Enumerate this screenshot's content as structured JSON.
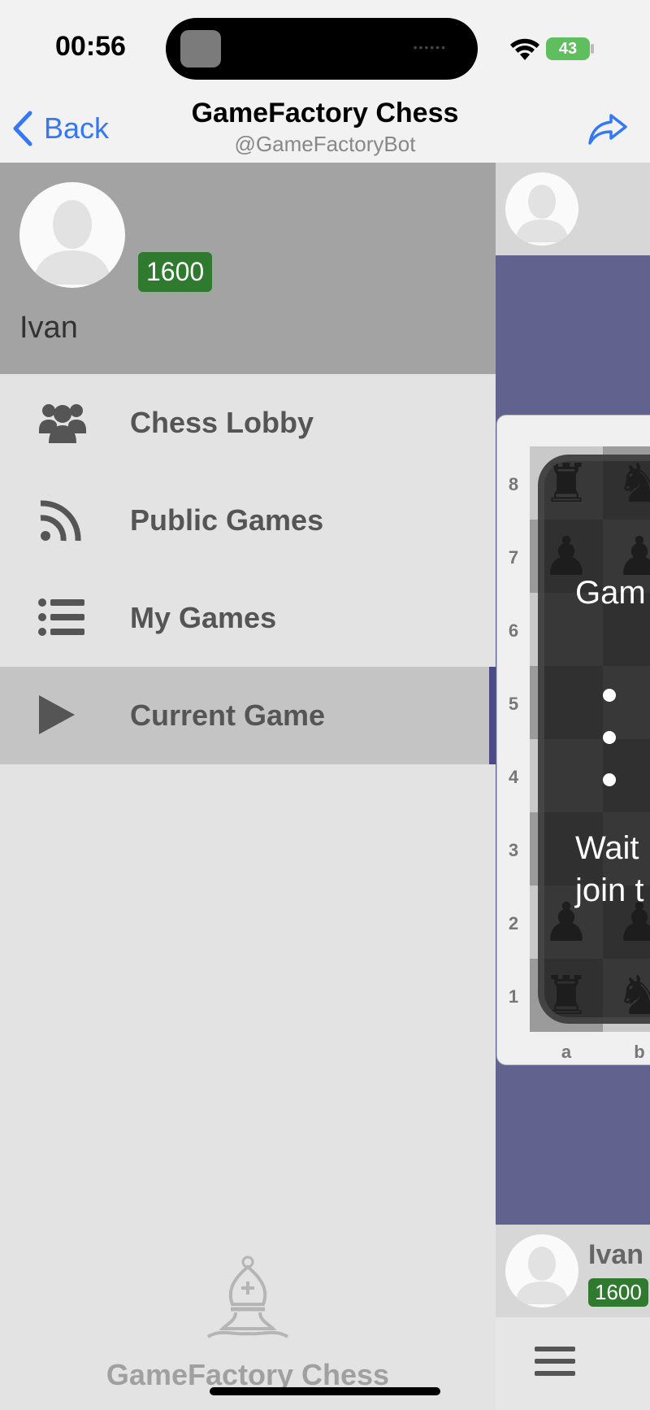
{
  "status_bar": {
    "time": "00:56",
    "battery": "43"
  },
  "nav": {
    "back_label": "Back",
    "title": "GameFactory Chess",
    "subtitle": "@GameFactoryBot"
  },
  "drawer": {
    "user": {
      "name": "Ivan",
      "rating": "1600"
    },
    "menu": [
      {
        "label": "Chess Lobby",
        "icon": "users-icon",
        "active": false
      },
      {
        "label": "Public Games",
        "icon": "rss-icon",
        "active": false
      },
      {
        "label": "My Games",
        "icon": "list-icon",
        "active": false
      },
      {
        "label": "Current Game",
        "icon": "play-icon",
        "active": true
      }
    ],
    "footer_text": "GameFactory Chess",
    "footer_icon": "bishop-logo-icon"
  },
  "game": {
    "ranks": [
      "8",
      "7",
      "6",
      "5",
      "4",
      "3",
      "2",
      "1"
    ],
    "files": [
      "a",
      "b"
    ],
    "overlay": {
      "title": "Gam",
      "wait_line1": "Wait",
      "wait_line2": "join t"
    },
    "bottom_player": {
      "name": "Ivan",
      "rating": "1600"
    }
  },
  "colors": {
    "accent": "#3478f6",
    "rating_badge": "#2f7a2f",
    "board_bg": "#62628f",
    "drawer_header": "#a3a3a3"
  }
}
